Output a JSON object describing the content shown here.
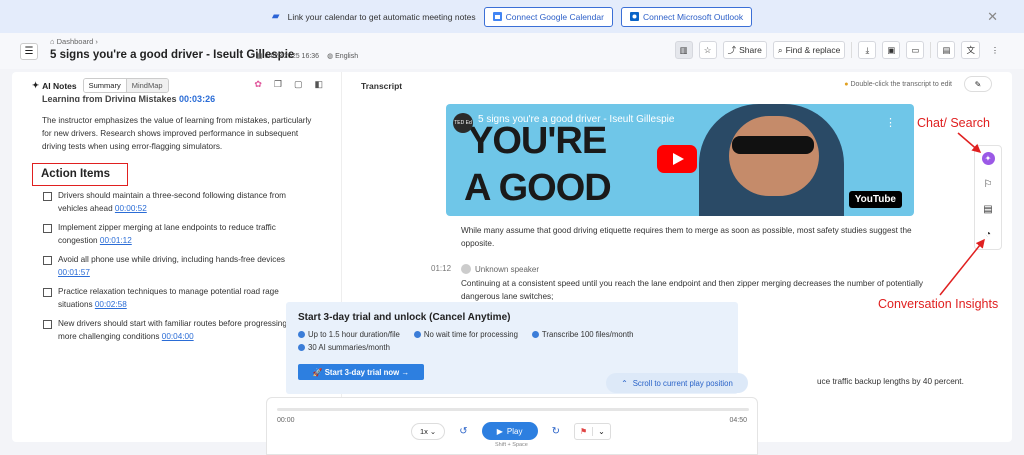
{
  "banner": {
    "text": "Link your calendar to get automatic meeting notes",
    "google_btn": "Connect Google Calendar",
    "outlook_btn": "Connect Microsoft Outlook"
  },
  "header": {
    "breadcrumb": "Dashboard",
    "title": "5 signs you're a good driver - Iseult Gillespie",
    "date": "04/23/2025 16:36",
    "language": "English",
    "share_label": "Share",
    "find_label": "Find & replace"
  },
  "left": {
    "ai_notes_label": "AI Notes",
    "tab_summary": "Summary",
    "tab_mindmap": "MindMap",
    "cut_heading": "Learning from Driving Mistakes",
    "cut_timestamp": "00:03:26",
    "paragraph": "The instructor emphasizes the value of learning from mistakes, particularly for new drivers. Research shows improved performance in subsequent driving tests when using error-flagging simulators.",
    "action_items_heading": "Action Items",
    "action_items": [
      {
        "text": "Drivers should maintain a three-second following distance from vehicles ahead",
        "ts": "00:00:52"
      },
      {
        "text": "Implement zipper merging at lane endpoints to reduce traffic congestion",
        "ts": "00:01:12"
      },
      {
        "text": "Avoid all phone use while driving, including hands-free devices",
        "ts": "00:01:57"
      },
      {
        "text": "Practice relaxation techniques to manage potential road rage situations",
        "ts": "00:02:58"
      },
      {
        "text": "New drivers should start with familiar routes before progressing to more challenging conditions",
        "ts": "00:04:00"
      }
    ]
  },
  "transcript": {
    "label": "Transcript",
    "edit_hint": "Double-click the transcript to edit",
    "video_title": "5 signs you're a good driver - Iseult Gillespie",
    "video_text_line1": "YOU'RE",
    "video_text_line2": "A GOOD",
    "channel_logo": "TED Ed",
    "youtube_label": "YouTube",
    "para1": "While many assume that good driving etiquette requires them to merge as soon as possible, most safety studies suggest the opposite.",
    "timestamp": "01:12",
    "speaker": "Unknown speaker",
    "para2": "Continuing at a consistent speed until you reach the lane endpoint and then zipper merging decreases the number of potentially dangerous lane switches;",
    "para3": "uce traffic backup lengths by 40 percent."
  },
  "annotations": {
    "chat_search": "Chat/ Search",
    "conversation_insights": "Conversation Insights"
  },
  "promo": {
    "title": "Start 3-day trial and unlock (Cancel Anytime)",
    "features": [
      "Up to 1.5 hour duration/file",
      "No wait time for processing",
      "Transcribe 100 files/month",
      "30 AI summaries/month"
    ],
    "cta": "Start 3-day trial now"
  },
  "scroll_pill": "Scroll to current play position",
  "player": {
    "time_start": "00:00",
    "time_end": "04:50",
    "speed": "1x",
    "play_label": "Play",
    "shortcut_hint": "Shift + Space",
    "progress": 0
  }
}
